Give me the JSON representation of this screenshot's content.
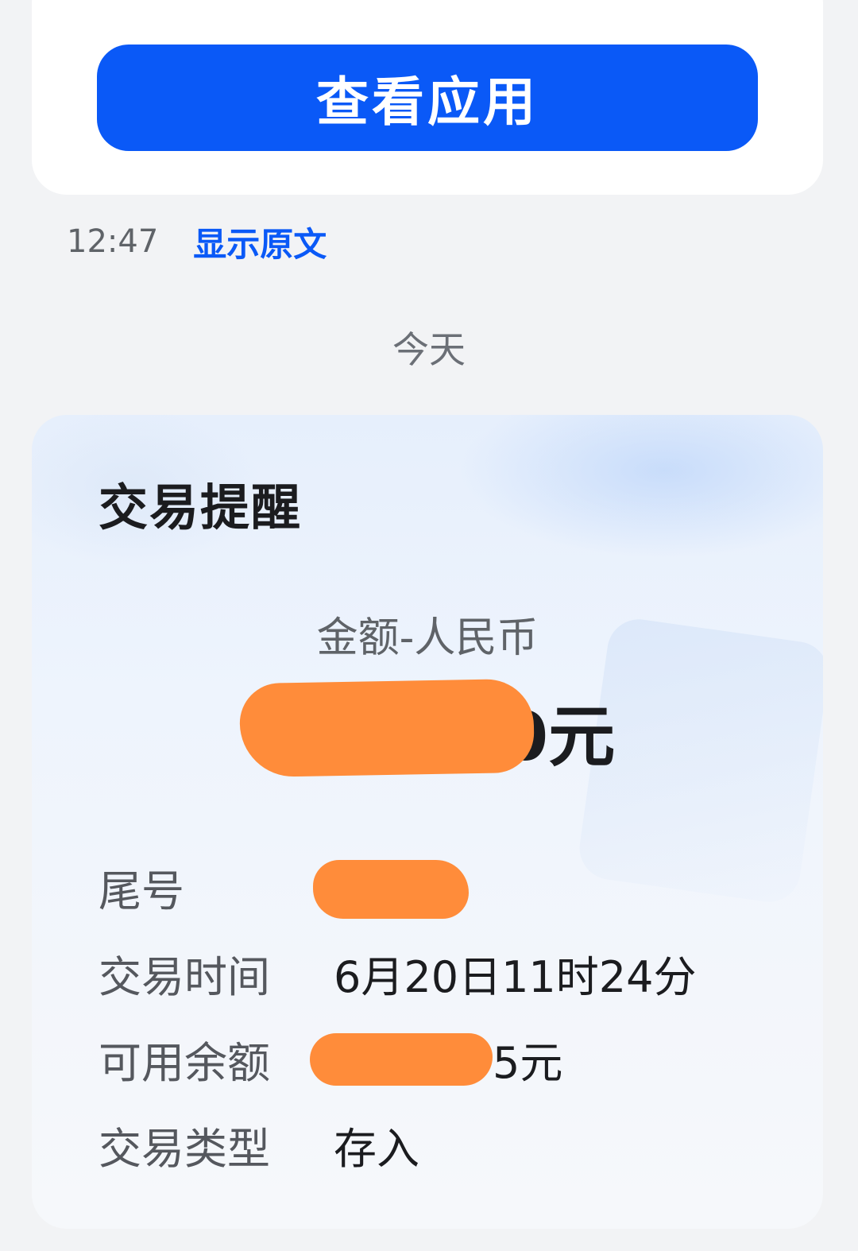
{
  "top_card": {
    "button_label": "查看应用"
  },
  "message_meta": {
    "time": "12:47",
    "show_original": "显示原文"
  },
  "date_separator": "今天",
  "transaction": {
    "title": "交易提醒",
    "amount_label": "金额-人民币",
    "amount_value": "0元",
    "rows": [
      {
        "key": "尾号",
        "value": ""
      },
      {
        "key": "交易时间",
        "value": "6月20日11时24分"
      },
      {
        "key": "可用余额",
        "value": "5元"
      },
      {
        "key": "交易类型",
        "value": "存入"
      }
    ]
  },
  "colors": {
    "accent": "#0a59f7",
    "redaction": "#ff8c3a",
    "background": "#f2f3f5"
  }
}
